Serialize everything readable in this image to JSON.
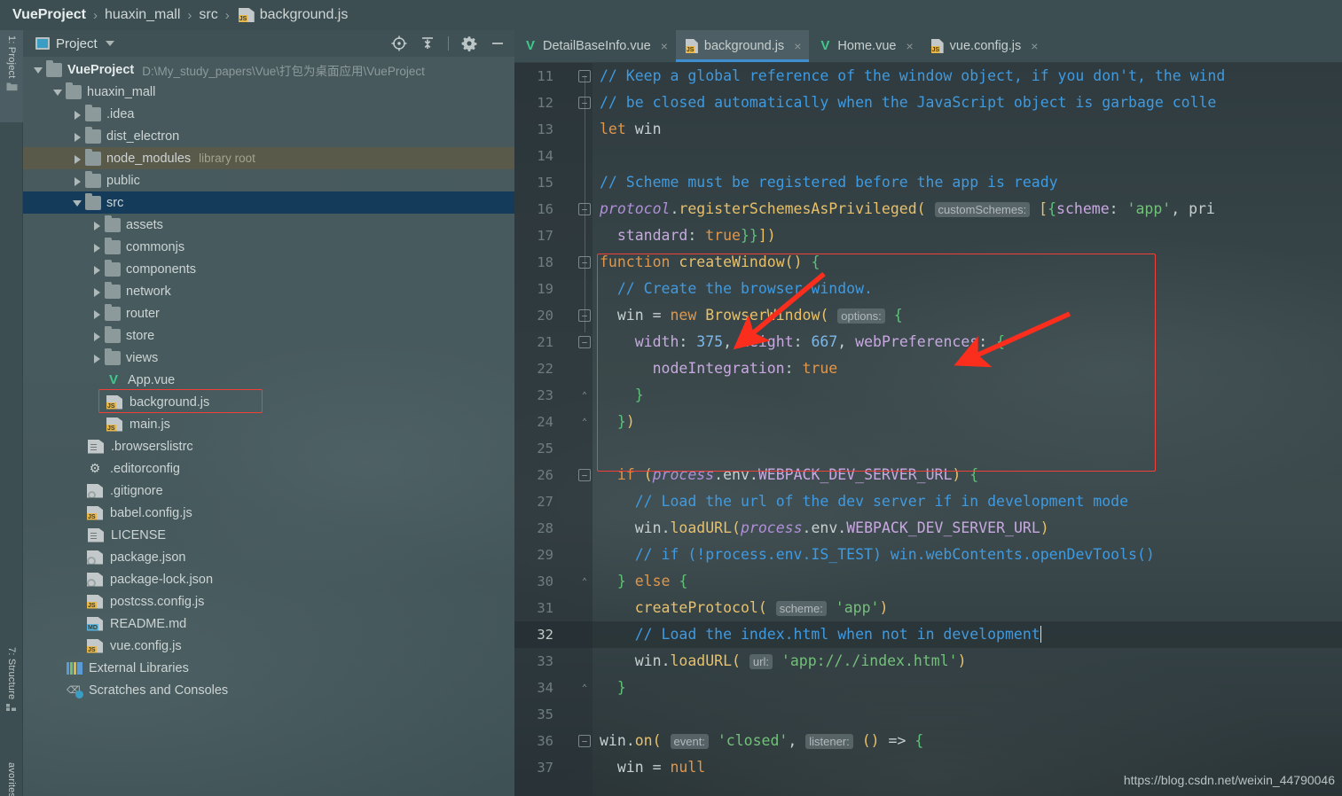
{
  "breadcrumb": {
    "items": [
      {
        "label": "VueProject",
        "icon": "none",
        "bold": true
      },
      {
        "label": "huaxin_mall",
        "icon": "none",
        "bold": false
      },
      {
        "label": "src",
        "icon": "none",
        "bold": false
      },
      {
        "label": "background.js",
        "icon": "js-file-icon",
        "bold": false
      }
    ],
    "separator": "›"
  },
  "toolstrip": {
    "tabs": [
      {
        "label": "1: Project",
        "active": true,
        "icon": "project-folder-icon"
      },
      {
        "label": "7: Structure",
        "active": false,
        "icon": "structure-icon"
      },
      {
        "label": "avorites",
        "active": false,
        "icon": "none"
      }
    ]
  },
  "project_panel": {
    "header": {
      "title": "Project",
      "icon": "project-window-icon",
      "caret": "chevron-down-icon",
      "tools": [
        {
          "name": "locate-in-tree-icon",
          "title": "Select Opened File"
        },
        {
          "name": "collapse-all-icon",
          "title": "Collapse All"
        },
        {
          "name": "gear-icon",
          "title": "Settings"
        },
        {
          "name": "minimize-icon",
          "title": "Hide"
        }
      ]
    },
    "tree": [
      {
        "label": "VueProject",
        "note": "D:\\My_study_papers\\Vue\\打包为桌面应用\\VueProject",
        "icon": "folder",
        "arrow": "open",
        "indent": 0,
        "bold": true,
        "state": "none"
      },
      {
        "label": "huaxin_mall",
        "note": "",
        "icon": "folder",
        "arrow": "open",
        "indent": 1,
        "bold": false,
        "state": "none"
      },
      {
        "label": ".idea",
        "note": "",
        "icon": "folder",
        "arrow": "closed",
        "indent": 2,
        "bold": false,
        "state": "none"
      },
      {
        "label": "dist_electron",
        "note": "",
        "icon": "folder",
        "arrow": "closed",
        "indent": 2,
        "bold": false,
        "state": "none"
      },
      {
        "label": "node_modules",
        "note": "library root",
        "icon": "folder",
        "arrow": "closed",
        "indent": 2,
        "bold": false,
        "state": "lib"
      },
      {
        "label": "public",
        "note": "",
        "icon": "folder",
        "arrow": "closed",
        "indent": 2,
        "bold": false,
        "state": "none"
      },
      {
        "label": "src",
        "note": "",
        "icon": "folder",
        "arrow": "open",
        "indent": 2,
        "bold": false,
        "state": "sel"
      },
      {
        "label": "assets",
        "note": "",
        "icon": "folder",
        "arrow": "closed",
        "indent": 3,
        "bold": false,
        "state": "none"
      },
      {
        "label": "commonjs",
        "note": "",
        "icon": "folder",
        "arrow": "closed",
        "indent": 3,
        "bold": false,
        "state": "none"
      },
      {
        "label": "components",
        "note": "",
        "icon": "folder",
        "arrow": "closed",
        "indent": 3,
        "bold": false,
        "state": "none"
      },
      {
        "label": "network",
        "note": "",
        "icon": "folder",
        "arrow": "closed",
        "indent": 3,
        "bold": false,
        "state": "none"
      },
      {
        "label": "router",
        "note": "",
        "icon": "folder",
        "arrow": "closed",
        "indent": 3,
        "bold": false,
        "state": "none"
      },
      {
        "label": "store",
        "note": "",
        "icon": "folder",
        "arrow": "closed",
        "indent": 3,
        "bold": false,
        "state": "none"
      },
      {
        "label": "views",
        "note": "",
        "icon": "folder",
        "arrow": "closed",
        "indent": 3,
        "bold": false,
        "state": "none"
      },
      {
        "label": "App.vue",
        "note": "",
        "icon": "vue",
        "arrow": "none",
        "indent": 3,
        "bold": false,
        "state": "none"
      },
      {
        "label": "background.js",
        "note": "",
        "icon": "js",
        "arrow": "none",
        "indent": 3,
        "bold": false,
        "state": "none"
      },
      {
        "label": "main.js",
        "note": "",
        "icon": "js",
        "arrow": "none",
        "indent": 3,
        "bold": false,
        "state": "none"
      },
      {
        "label": ".browserslistrc",
        "note": "",
        "icon": "plain",
        "arrow": "none",
        "indent": 2,
        "bold": false,
        "state": "none"
      },
      {
        "label": ".editorconfig",
        "note": "",
        "icon": "gear",
        "arrow": "none",
        "indent": 2,
        "bold": false,
        "state": "none"
      },
      {
        "label": ".gitignore",
        "note": "",
        "icon": "gitignore",
        "arrow": "none",
        "indent": 2,
        "bold": false,
        "state": "none"
      },
      {
        "label": "babel.config.js",
        "note": "",
        "icon": "js",
        "arrow": "none",
        "indent": 2,
        "bold": false,
        "state": "none"
      },
      {
        "label": "LICENSE",
        "note": "",
        "icon": "plain",
        "arrow": "none",
        "indent": 2,
        "bold": false,
        "state": "none"
      },
      {
        "label": "package.json",
        "note": "",
        "icon": "json",
        "arrow": "none",
        "indent": 2,
        "bold": false,
        "state": "none"
      },
      {
        "label": "package-lock.json",
        "note": "",
        "icon": "json",
        "arrow": "none",
        "indent": 2,
        "bold": false,
        "state": "none"
      },
      {
        "label": "postcss.config.js",
        "note": "",
        "icon": "js",
        "arrow": "none",
        "indent": 2,
        "bold": false,
        "state": "none"
      },
      {
        "label": "README.md",
        "note": "",
        "icon": "md",
        "arrow": "none",
        "indent": 2,
        "bold": false,
        "state": "none"
      },
      {
        "label": "vue.config.js",
        "note": "",
        "icon": "js",
        "arrow": "none",
        "indent": 2,
        "bold": false,
        "state": "none"
      },
      {
        "label": "External Libraries",
        "note": "",
        "icon": "libs",
        "arrow": "none",
        "indent": 1,
        "bold": false,
        "state": "none"
      },
      {
        "label": "Scratches and Consoles",
        "note": "",
        "icon": "scratch",
        "arrow": "none",
        "indent": 1,
        "bold": false,
        "state": "none"
      }
    ],
    "highlight_index": 15
  },
  "editor": {
    "tabs": [
      {
        "label": "DetailBaseInfo.vue",
        "icon": "vue",
        "active": false,
        "close": "×"
      },
      {
        "label": "background.js",
        "icon": "js",
        "active": true,
        "close": "×"
      },
      {
        "label": "Home.vue",
        "icon": "vue",
        "active": false,
        "close": "×"
      },
      {
        "label": "vue.config.js",
        "icon": "js",
        "active": false,
        "close": "×"
      }
    ],
    "current_line": 32,
    "lines": [
      {
        "n": 11,
        "text": "// Keep a global reference of the window object, if you don't, the wind"
      },
      {
        "n": 12,
        "text": "// be closed automatically when the JavaScript object is garbage colle"
      },
      {
        "n": 13,
        "text": "let win"
      },
      {
        "n": 14,
        "text": ""
      },
      {
        "n": 15,
        "text": "// Scheme must be registered before the app is ready"
      },
      {
        "n": 16,
        "text": "protocol.registerSchemesAsPrivileged( customSchemes: [{scheme: 'app', pri"
      },
      {
        "n": 17,
        "text": "  standard: true}}])"
      },
      {
        "n": 18,
        "text": "function createWindow() {"
      },
      {
        "n": 19,
        "text": "  // Create the browser window."
      },
      {
        "n": 20,
        "text": "  win = new BrowserWindow( options: {"
      },
      {
        "n": 21,
        "text": "    width: 375, height: 667, webPreferences: {"
      },
      {
        "n": 22,
        "text": "      nodeIntegration: true"
      },
      {
        "n": 23,
        "text": "    }"
      },
      {
        "n": 24,
        "text": "  })"
      },
      {
        "n": 25,
        "text": ""
      },
      {
        "n": 26,
        "text": "  if (process.env.WEBPACK_DEV_SERVER_URL) {"
      },
      {
        "n": 27,
        "text": "    // Load the url of the dev server if in development mode"
      },
      {
        "n": 28,
        "text": "    win.loadURL(process.env.WEBPACK_DEV_SERVER_URL)"
      },
      {
        "n": 29,
        "text": "    // if (!process.env.IS_TEST) win.webContents.openDevTools()"
      },
      {
        "n": 30,
        "text": "  } else {"
      },
      {
        "n": 31,
        "text": "    createProtocol( scheme: 'app')"
      },
      {
        "n": 32,
        "text": "    // Load the index.html when not in development"
      },
      {
        "n": 33,
        "text": "    win.loadURL( url: 'app://./index.html')"
      },
      {
        "n": 34,
        "text": "  }"
      },
      {
        "n": 35,
        "text": ""
      },
      {
        "n": 36,
        "text": "win.on( event: 'closed', listener: () => {"
      },
      {
        "n": 37,
        "text": "  win = null"
      }
    ],
    "annotations": {
      "box_color": "#f04038",
      "arrow_color": "#fb2e1e",
      "arrow_targets": [
        "createWindow()",
        "width: 375,"
      ]
    }
  },
  "watermark": "https://blog.csdn.net/weixin_44790046",
  "colors": {
    "accent_blue": "#3e8ed0",
    "selection": "#143c5a",
    "library_row": "#5a5a4a",
    "annotation_red": "#f04038",
    "panel_bg": "#46585c",
    "toolbar_bg": "#3c4e52",
    "editor_bg": "#2b3337"
  }
}
